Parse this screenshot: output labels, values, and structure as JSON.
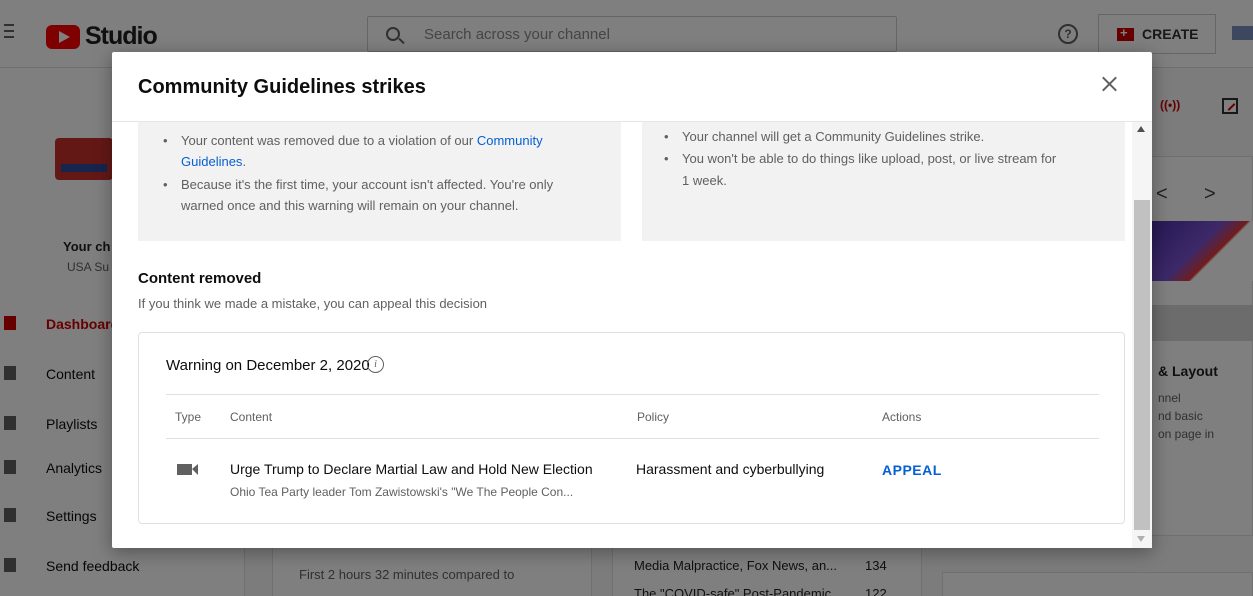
{
  "app": {
    "logo_text": "Studio",
    "search_placeholder": "Search across your channel",
    "help_glyph": "?",
    "create_label": "CREATE"
  },
  "sidebar": {
    "channel_heading": "Your ch",
    "channel_name": "USA Su",
    "items": [
      {
        "label": "Dashboard",
        "icon": "dashboard-icon",
        "active": true
      },
      {
        "label": "Content",
        "icon": "content-icon"
      },
      {
        "label": "Playlists",
        "icon": "playlists-icon"
      },
      {
        "label": "Analytics",
        "icon": "analytics-icon"
      },
      {
        "label": "Settings",
        "icon": "settings-icon"
      },
      {
        "label": "Send feedback",
        "icon": "feedback-icon"
      }
    ]
  },
  "background": {
    "main_text": "First 2 hours 32 minutes compared to",
    "top_videos": [
      {
        "title": "Media Malpractice, Fox News, an...",
        "views": "134"
      },
      {
        "title": "The \"COVID-safe\" Post-Pandemic...",
        "views": "122"
      }
    ],
    "right_card": {
      "live_glyph": "((•))",
      "prev_glyph": "<",
      "next_glyph": ">",
      "title": "& Layout",
      "lines": [
        "nnel",
        "nd basic",
        "on page in"
      ]
    }
  },
  "dialog": {
    "title": "Community Guidelines strikes",
    "left_box": {
      "line1_prefix": "Your content was removed due to a violation of our ",
      "line1_link": "Community",
      "line2_link": "Guidelines",
      "line2_suffix": ".",
      "line3": "Because it's the first time, your account isn't affected. You're only",
      "line4": "warned once and this warning will remain on your channel."
    },
    "right_box": {
      "line1": "Your channel will get a Community Guidelines strike.",
      "line2": "You won't be able to do things like upload, post, or live stream for",
      "line3": "1 week."
    },
    "section_title": "Content removed",
    "section_subtitle": "If you think we made a mistake, you can appeal this decision",
    "warning": {
      "title": "Warning on December 2, 2020",
      "info_glyph": "i",
      "columns": [
        "Type",
        "Content",
        "Policy",
        "Actions"
      ],
      "row": {
        "type_icon": "video-camera-icon",
        "content_title": "Urge Trump to Declare Martial Law and Hold New Election",
        "content_desc": "Ohio Tea Party leader Tom Zawistowski's \"We The People Con...",
        "policy": "Harassment and cyberbullying",
        "action": "APPEAL"
      }
    }
  },
  "colors": {
    "brand_red": "#ff0000",
    "link_blue": "#065fd4",
    "info_box_bg": "#f2f2f2"
  }
}
